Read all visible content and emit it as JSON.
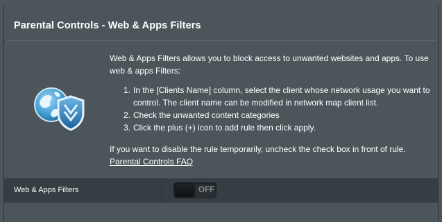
{
  "header": {
    "title": "Parental Controls - Web & Apps Filters"
  },
  "info": {
    "icon": "globe-shield-icon",
    "intro": "Web & Apps Filters allows you to block access to unwanted websites and apps. To use web & apps Filters:",
    "steps": [
      {
        "num": "1.",
        "text": "In the [Clients Name] column, select the client whose network usage you want to control. The client name can be modified in network map client list."
      },
      {
        "num": "2.",
        "text": "Check the unwanted content categories"
      },
      {
        "num": "3.",
        "text": "Click the plus (+) icon to add rule then click apply."
      }
    ],
    "note": "If you want to disable the rule temporarily, uncheck the check box in front of rule.",
    "faq_link": "Parental Controls FAQ"
  },
  "filter_row": {
    "label": "Web & Apps Filters",
    "toggle_state": "OFF"
  },
  "colors": {
    "background": "#4c565a",
    "row_background": "#353e42",
    "globe_blue": "#4aa3d8",
    "shield_blue": "#2d7fc0"
  }
}
